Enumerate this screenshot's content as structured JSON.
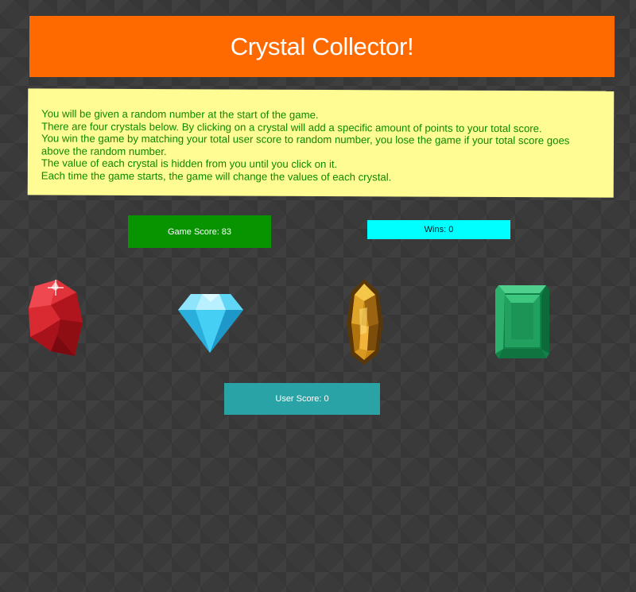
{
  "header": {
    "title": "Crystal Collector!"
  },
  "instructions": {
    "lines": [
      "You will be given a random number at the start of the game.",
      "There are four crystals below. By clicking on a crystal will add a specific amount of points to your total score.",
      "You win the game by matching your total user score to random number, you lose the game if your total score goes above the random number.",
      "The value of each crystal is hidden from you until you click on it.",
      "Each time the game starts, the game will change the values of each crystal."
    ]
  },
  "scoreboard": {
    "game_score_label": "Game Score: 83",
    "wins_label": "Wins: 0",
    "user_score_label": "User Score: 0"
  },
  "crystals": [
    {
      "name": "red-crystal",
      "color": "#d8202a"
    },
    {
      "name": "blue-crystal",
      "color": "#36c6ee"
    },
    {
      "name": "amber-crystal",
      "color": "#d89a1c"
    },
    {
      "name": "green-crystal",
      "color": "#1f9e5c"
    }
  ],
  "colors": {
    "header_bg": "#ff6a00",
    "instructions_bg": "#fffc93",
    "instructions_text": "#0d8a00",
    "game_score_bg": "#079400",
    "wins_bg": "#00ffff",
    "user_score_bg": "#2aa3a7"
  }
}
